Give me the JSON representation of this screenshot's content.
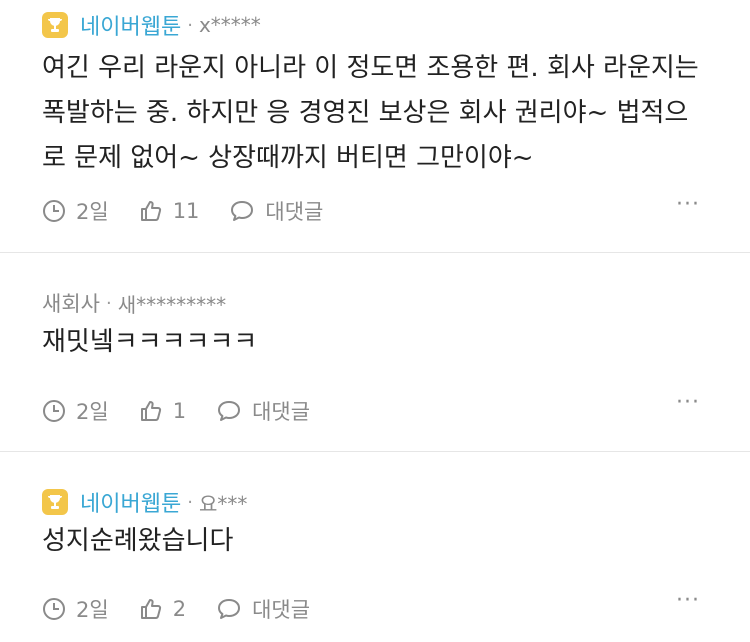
{
  "comments": [
    {
      "nick": "네이버웹툰",
      "sep": "·",
      "uid": "x*****",
      "text": "여긴 우리 라운지 아니라 이 정도면 조용한 편. 회사 라운지는 폭발하는 중. 하지만 응 경영진 보상은 회사 권리야~ 법적으로 문제 없어~ 상장때까지 버티면 그만이야~",
      "time": "2일",
      "likes": "11",
      "reply": "대댓글",
      "more": "···"
    },
    {
      "nick": "새회사",
      "sep": "·",
      "uid": "새*********",
      "text": "재밋넼ㅋㅋㅋㅋㅋㅋ",
      "time": "2일",
      "likes": "1",
      "reply": "대댓글",
      "more": "···"
    },
    {
      "nick": "네이버웹툰",
      "sep": "·",
      "uid": "요***",
      "text": "성지순례왔습니다",
      "time": "2일",
      "likes": "2",
      "reply": "대댓글",
      "more": "···"
    }
  ],
  "icons": {
    "badge": "trophy-icon",
    "time": "clock-icon",
    "like": "thumbs-up-icon",
    "reply": "chat-bubble-icon",
    "more": "more-dots-icon"
  },
  "colors": {
    "brand": "#3aa7d4",
    "badge": "#f3c64a",
    "meta": "#8a8a8a"
  }
}
